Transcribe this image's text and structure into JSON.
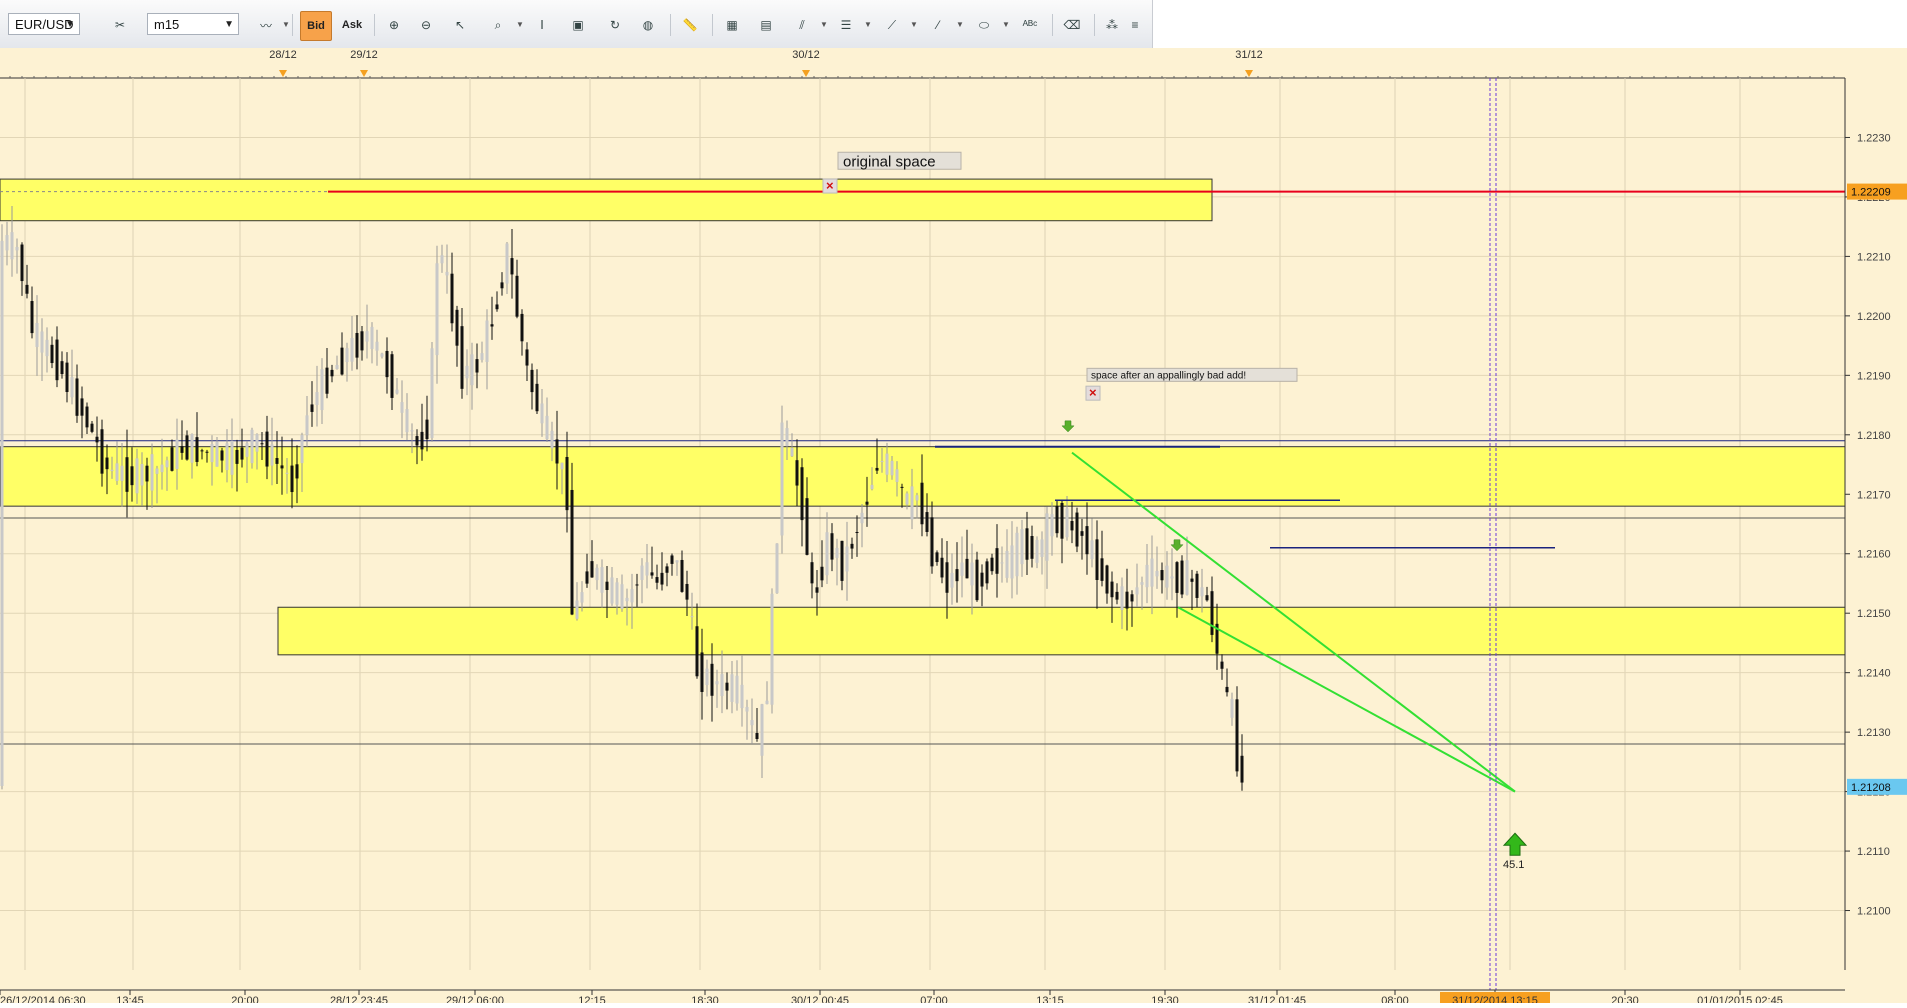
{
  "toolbar": {
    "symbol": "EUR/USD",
    "timeframe": "m15",
    "bid_label": "Bid",
    "ask_label": "Ask"
  },
  "colors": {
    "background": "#fdf2d3",
    "zone": "#ffff66",
    "resistance_line": "#e8001c",
    "trendline": "#33e033",
    "level_line": "#1a237e",
    "last_price_tag": "#6ac8f0",
    "time_cursor_tag": "#f7a020"
  },
  "chart_data": {
    "type": "candlestick",
    "symbol": "EUR/USD",
    "timeframe": "m15",
    "ylim": [
      1.209,
      1.224
    ],
    "grid": true,
    "y_ticks": [
      "1.2100",
      "1.2110",
      "1.2120",
      "1.2130",
      "1.2140",
      "1.2150",
      "1.2160",
      "1.2170",
      "1.2180",
      "1.2190",
      "1.2200",
      "1.2210",
      "1.2220",
      "1.2230"
    ],
    "x_labels": [
      "26/12/2014 06:30",
      "13:45",
      "20:00",
      "28/12 23:45",
      "29/12 06:00",
      "12:15",
      "18:30",
      "30/12 00:45",
      "07:00",
      "13:15",
      "19:30",
      "31/12 01:45",
      "08:00",
      "31/12/2014 13:15",
      "20:30",
      "01/01/2015 02:45"
    ],
    "day_markers": [
      "28/12",
      "29/12",
      "30/12",
      "31/12"
    ],
    "resistance_price": "1.22209",
    "last_price": "1.21208",
    "time_cursor": "31/12/2014 13:15",
    "annotations": [
      {
        "text": "original space",
        "price": 1.2226
      },
      {
        "text": "space after an appallingly bad add!",
        "price": 1.219
      }
    ],
    "arrow_label": "45.1",
    "zones": [
      {
        "top": 1.2223,
        "bottom": 1.2216
      },
      {
        "top": 1.2178,
        "bottom": 1.2168
      },
      {
        "top": 1.2151,
        "bottom": 1.2143
      }
    ],
    "horizontal_levels": [
      1.2179,
      1.2166,
      1.2128
    ],
    "short_levels": [
      1.2178,
      1.2169,
      1.2161
    ],
    "candle_path": [
      [
        0,
        1.2213
      ],
      [
        20,
        1.2211
      ],
      [
        35,
        1.2197
      ],
      [
        60,
        1.2192
      ],
      [
        90,
        1.2182
      ],
      [
        110,
        1.2174
      ],
      [
        135,
        1.2173
      ],
      [
        160,
        1.2174
      ],
      [
        185,
        1.2178
      ],
      [
        210,
        1.2177
      ],
      [
        235,
        1.2176
      ],
      [
        260,
        1.2179
      ],
      [
        280,
        1.2175
      ],
      [
        295,
        1.2172
      ],
      [
        310,
        1.2184
      ],
      [
        330,
        1.219
      ],
      [
        350,
        1.2194
      ],
      [
        370,
        1.2197
      ],
      [
        390,
        1.2191
      ],
      [
        405,
        1.2183
      ],
      [
        420,
        1.2178
      ],
      [
        432,
        1.2183
      ],
      [
        440,
        1.2212
      ],
      [
        450,
        1.2205
      ],
      [
        465,
        1.219
      ],
      [
        480,
        1.2192
      ],
      [
        495,
        1.22
      ],
      [
        510,
        1.2211
      ],
      [
        520,
        1.22
      ],
      [
        530,
        1.219
      ],
      [
        545,
        1.2182
      ],
      [
        560,
        1.2176
      ],
      [
        570,
        1.217
      ],
      [
        575,
        1.2148
      ],
      [
        590,
        1.2158
      ],
      [
        610,
        1.2154
      ],
      [
        630,
        1.2152
      ],
      [
        645,
        1.2158
      ],
      [
        660,
        1.2155
      ],
      [
        675,
        1.216
      ],
      [
        690,
        1.2152
      ],
      [
        700,
        1.214
      ],
      [
        720,
        1.2138
      ],
      [
        740,
        1.2137
      ],
      [
        760,
        1.2128
      ],
      [
        770,
        1.2138
      ],
      [
        778,
        1.216
      ],
      [
        785,
        1.2182
      ],
      [
        795,
        1.2175
      ],
      [
        805,
        1.2168
      ],
      [
        815,
        1.2152
      ],
      [
        830,
        1.2162
      ],
      [
        845,
        1.2158
      ],
      [
        860,
        1.2165
      ],
      [
        870,
        1.217
      ],
      [
        880,
        1.2176
      ],
      [
        895,
        1.2174
      ],
      [
        910,
        1.2168
      ],
      [
        920,
        1.217
      ],
      [
        935,
        1.216
      ],
      [
        950,
        1.2155
      ],
      [
        965,
        1.2158
      ],
      [
        980,
        1.2155
      ],
      [
        995,
        1.2159
      ],
      [
        1010,
        1.2158
      ],
      [
        1025,
        1.2162
      ],
      [
        1040,
        1.216
      ],
      [
        1055,
        1.2166
      ],
      [
        1070,
        1.2165
      ],
      [
        1085,
        1.2163
      ],
      [
        1100,
        1.2158
      ],
      [
        1115,
        1.2153
      ],
      [
        1130,
        1.2152
      ],
      [
        1150,
        1.2157
      ],
      [
        1170,
        1.2156
      ],
      [
        1190,
        1.2156
      ],
      [
        1210,
        1.2152
      ],
      [
        1220,
        1.2143
      ],
      [
        1228,
        1.2136
      ],
      [
        1236,
        1.2132
      ],
      [
        1242,
        1.2122
      ],
      [
        1246,
        1.2121
      ]
    ]
  }
}
